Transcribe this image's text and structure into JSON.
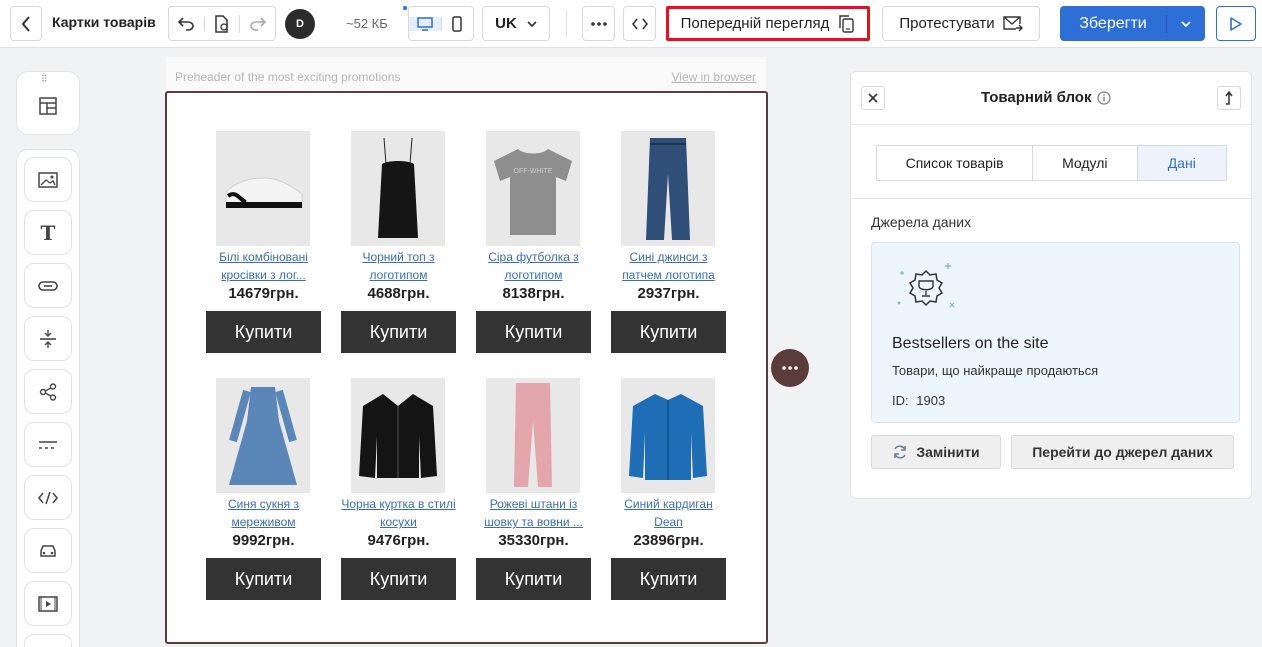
{
  "header": {
    "title": "Картки товарів",
    "avatar_initial": "D",
    "size": "~52 КБ",
    "language": "UK",
    "preview_label": "Попередній перегляд",
    "test_label": "Протестувати",
    "save_label": "Зберегти"
  },
  "canvas": {
    "preheader": "Preheader of the most exciting promotions",
    "view_in_browser": "View in browser",
    "products": [
      {
        "name": "Білі комбіновані кросівки з лог...",
        "price": "14679грн.",
        "buy": "Купити"
      },
      {
        "name": "Чорний топ з логотипом",
        "price": "4688грн.",
        "buy": "Купити"
      },
      {
        "name": "Сіра футболка з логотипом",
        "price": "8138грн.",
        "buy": "Купити"
      },
      {
        "name": "Сині джинси з патчем логотипа",
        "price": "2937грн.",
        "buy": "Купити"
      },
      {
        "name": "Синя сукня з мереживом",
        "price": "9992грн.",
        "buy": "Купити"
      },
      {
        "name": "Чорна куртка в стилі косухи",
        "price": "9476грн.",
        "buy": "Купити"
      },
      {
        "name": "Рожеві штани із шовку та вовни ...",
        "price": "35330грн.",
        "buy": "Купити"
      },
      {
        "name": "Синий кардиган Dean",
        "price": "23896грн.",
        "buy": "Купити"
      }
    ]
  },
  "panel": {
    "title": "Товарний блок",
    "tabs": [
      "Список товарів",
      "Модулі",
      "Дані"
    ],
    "active_tab": "Дані",
    "data_sources_label": "Джерела даних",
    "source_title": "Bestsellers on the site",
    "source_description": "Товари, що найкраще продаються",
    "source_id_label": "ID:",
    "source_id": "1903",
    "replace_label": "Замінити",
    "goto_label": "Перейти до джерел даних"
  },
  "colors": {
    "accent": "#2d6fd6",
    "highlight": "#e3121d",
    "email_border": "#5a3c3a",
    "buy_button": "#333333"
  }
}
